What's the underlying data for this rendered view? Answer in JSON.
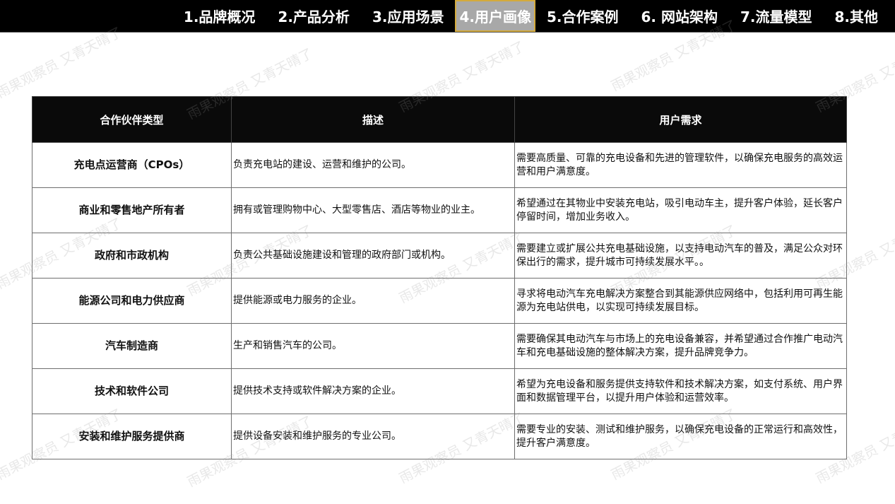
{
  "nav": {
    "items": [
      {
        "label": "1.品牌概况",
        "active": false
      },
      {
        "label": "2.产品分析",
        "active": false
      },
      {
        "label": "3.应用场景",
        "active": false
      },
      {
        "label": "4.用户画像",
        "active": true
      },
      {
        "label": "5.合作案例",
        "active": false
      },
      {
        "label": "6. 网站架构",
        "active": false
      },
      {
        "label": "7.流量模型",
        "active": false
      },
      {
        "label": "8.其他",
        "active": false
      }
    ]
  },
  "watermark": "雨果观察员 又青天晴了",
  "table": {
    "headers": [
      "合作伙伴类型",
      "描述",
      "用户需求"
    ],
    "rows": [
      {
        "type": "充电点运营商（CPOs）",
        "desc": "负责充电站的建设、运营和维护的公司。",
        "need": "需要高质量、可靠的充电设备和先进的管理软件，以确保充电服务的高效运营和用户满意度。"
      },
      {
        "type": "商业和零售地产所有者",
        "desc": "拥有或管理购物中心、大型零售店、酒店等物业的业主。",
        "need": "希望通过在其物业中安装充电站，吸引电动车主，提升客户体验，延长客户停留时间，增加业务收入。"
      },
      {
        "type": "政府和市政机构",
        "desc": "负责公共基础设施建设和管理的政府部门或机构。",
        "need": "需要建立或扩展公共充电基础设施，以支持电动汽车的普及，满足公众对环保出行的需求，提升城市可持续发展水平。。"
      },
      {
        "type": "能源公司和电力供应商",
        "desc": "提供能源或电力服务的企业。",
        "need": "寻求将电动汽车充电解决方案整合到其能源供应网络中，包括利用可再生能源为充电站供电，以实现可持续发展目标。"
      },
      {
        "type": "汽车制造商",
        "desc": "生产和销售汽车的公司。",
        "need": "需要确保其电动汽车与市场上的充电设备兼容，并希望通过合作推广电动汽车和充电基础设施的整体解决方案，提升品牌竞争力。"
      },
      {
        "type": "技术和软件公司",
        "desc": "提供技术支持或软件解决方案的企业。",
        "need": "希望为充电设备和服务提供支持软件和技术解决方案，如支付系统、用户界面和数据管理平台，以提升用户体验和运营效率。"
      },
      {
        "type": "安装和维护服务提供商",
        "desc": "提供设备安装和维护服务的专业公司。",
        "need": "需要专业的安装、测试和维护服务，以确保充电设备的正常运行和高效性，提升客户满意度。"
      }
    ]
  }
}
